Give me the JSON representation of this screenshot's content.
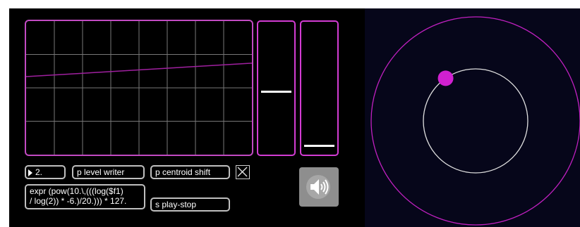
{
  "scope": {
    "grid_cols": 8,
    "grid_rows": 4,
    "trace_start_level": 0.416,
    "trace_end_level": 0.315,
    "trace_color": "#a020a0",
    "grid_color": "#777777",
    "border_color": "#c24ac2"
  },
  "meters": [
    {
      "level": 0.463
    },
    {
      "level": 0.043
    }
  ],
  "controls": {
    "number_value": "2.",
    "level_writer": "p level writer",
    "centroid_shift": "p centroid shift",
    "expr_line1": "expr (pow(10.\\,(((log($f1)",
    "expr_line2": "/ log(2)) * -6.)/20.))) * 127.",
    "play_stop": "s play-stop",
    "toggle_state": "on"
  },
  "speaker": {
    "icon": "speaker-icon",
    "background": "#8e8e8e"
  },
  "orbit": {
    "dot_angle_deg": 125,
    "outer_color": "#c020c0",
    "inner_color": "#e0e0e0",
    "dot_color": "#d020d0"
  }
}
